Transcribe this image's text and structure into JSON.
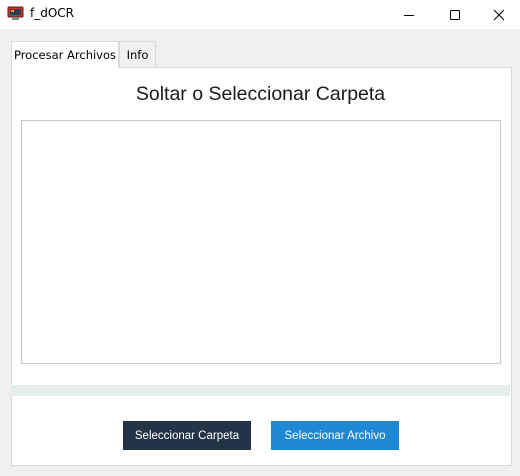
{
  "window": {
    "title": "f_dOCR",
    "controls": [
      "minimize-icon",
      "maximize-icon",
      "close-icon"
    ]
  },
  "tabs": [
    {
      "label": "Procesar Archivos",
      "active": true
    },
    {
      "label": "Info",
      "active": false
    }
  ],
  "main": {
    "heading": "Soltar o Seleccionar Carpeta",
    "progress": 0
  },
  "buttons": {
    "select_folder": "Seleccionar Carpeta",
    "select_file": "Seleccionar Archivo"
  },
  "colors": {
    "select_folder_bg": "#243447",
    "select_file_bg": "#1e88d5",
    "progress_track": "#e6eeed"
  }
}
